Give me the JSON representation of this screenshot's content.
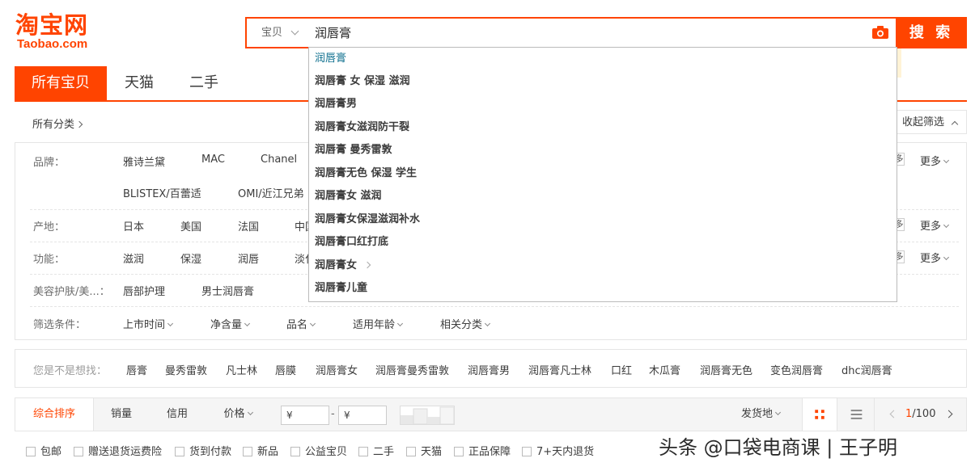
{
  "logo": {
    "cn": "淘宝网",
    "en": "Taobao.com"
  },
  "search": {
    "scope": "宝贝",
    "query": "润唇膏",
    "button": "搜 索"
  },
  "tabs": [
    "所有宝贝",
    "天猫",
    "二手"
  ],
  "breadcrumb": "所有分类",
  "collapse_filter": "收起筛选",
  "filters": {
    "brand": {
      "label": "品牌：",
      "row1": [
        "雅诗兰黛",
        "MAC",
        "Chanel"
      ],
      "row2": [
        "BLISTEX/百蕾适",
        "OMI/近江兄弟"
      ]
    },
    "origin": {
      "label": "产地：",
      "values": [
        "日本",
        "美国",
        "法国",
        "中国"
      ]
    },
    "function": {
      "label": "功能：",
      "values": [
        "滋润",
        "保湿",
        "润唇",
        "淡化"
      ]
    },
    "beauty": {
      "label": "美容护肤/美...：",
      "values": [
        "唇部护理",
        "男士润唇膏"
      ]
    },
    "conditions": {
      "label": "筛选条件：",
      "values": [
        "上市时间",
        "净含量",
        "品名",
        "适用年龄",
        "相关分类"
      ]
    },
    "more": "更多",
    "multi": "多选"
  },
  "related": {
    "label": "您是不是想找：",
    "items": [
      "唇膏",
      "曼秀雷敦",
      "凡士林",
      "唇膜",
      "润唇膏女",
      "润唇膏曼秀雷敦",
      "润唇膏男",
      "润唇膏凡士林",
      "口红",
      "木瓜膏",
      "润唇膏无色",
      "变色润唇膏",
      "dhc润唇膏"
    ]
  },
  "sortbar": {
    "items": [
      "综合排序",
      "销量",
      "信用",
      "价格"
    ],
    "price_placeholder": "¥",
    "price_dash": "-",
    "location": "发货地",
    "pager": {
      "current": "1",
      "total": "/100"
    }
  },
  "checkboxes": [
    "包邮",
    "赠送退货运费险",
    "货到付款",
    "新品",
    "公益宝贝",
    "二手",
    "天猫",
    "正品保障",
    "7+天内退货"
  ],
  "suggestions": [
    "润唇膏",
    "润唇膏 女 保湿 滋润",
    "润唇膏男",
    "润唇膏女滋润防干裂",
    "润唇膏 曼秀雷敦",
    "润唇膏无色 保湿 学生",
    "润唇膏女 滋润",
    "润唇膏女保湿滋润补水",
    "润唇膏口红打底",
    "润唇膏女",
    "润唇膏儿童"
  ],
  "watermark": "头条 @口袋电商课 | 王子明",
  "colors": {
    "accent": "#ff4400",
    "suggest_first": "#0e6f8e"
  }
}
